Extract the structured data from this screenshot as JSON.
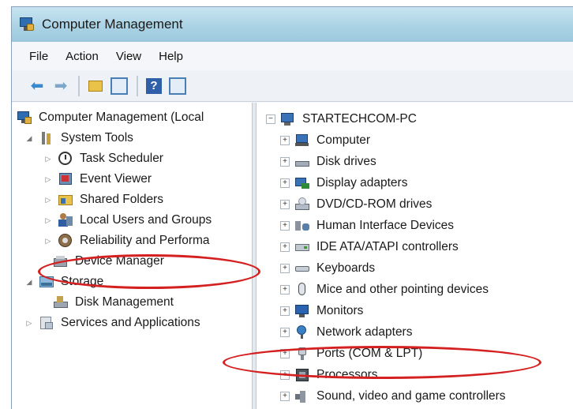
{
  "window": {
    "title": "Computer Management"
  },
  "menu": [
    "File",
    "Action",
    "View",
    "Help"
  ],
  "toolbar": [
    "back-arrow-icon",
    "forward-arrow-icon",
    "folder-up-icon",
    "show-hide-tree-icon",
    "help-icon",
    "properties-icon"
  ],
  "left_tree": [
    {
      "label": "Computer Management (Local",
      "icon": "computer-management-icon"
    },
    {
      "label": "System Tools",
      "icon": "tools-icon",
      "expander": "open"
    },
    {
      "label": "Task Scheduler",
      "icon": "clock-icon",
      "expander": "closed"
    },
    {
      "label": "Event Viewer",
      "icon": "event-viewer-icon",
      "expander": "closed"
    },
    {
      "label": "Shared Folders",
      "icon": "shared-folder-icon",
      "expander": "closed"
    },
    {
      "label": "Local Users and Groups",
      "icon": "users-icon",
      "expander": "closed"
    },
    {
      "label": "Reliability and Performa",
      "icon": "performance-icon",
      "expander": "closed"
    },
    {
      "label": "Device Manager",
      "icon": "device-manager-icon",
      "highlighted": true
    },
    {
      "label": "Storage",
      "icon": "storage-icon",
      "expander": "open"
    },
    {
      "label": "Disk Management",
      "icon": "disk-management-icon"
    },
    {
      "label": "Services and Applications",
      "icon": "services-icon",
      "expander": "closed"
    }
  ],
  "right_tree": {
    "root": "STARTECHCOM-PC",
    "items": [
      {
        "label": "Computer",
        "icon": "computer-icon"
      },
      {
        "label": "Disk drives",
        "icon": "disk-drive-icon"
      },
      {
        "label": "Display adapters",
        "icon": "display-adapter-icon"
      },
      {
        "label": "DVD/CD-ROM drives",
        "icon": "dvd-drive-icon"
      },
      {
        "label": "Human Interface Devices",
        "icon": "hid-icon"
      },
      {
        "label": "IDE ATA/ATAPI controllers",
        "icon": "ide-controller-icon"
      },
      {
        "label": "Keyboards",
        "icon": "keyboard-icon"
      },
      {
        "label": "Mice and other pointing devices",
        "icon": "mouse-icon"
      },
      {
        "label": "Monitors",
        "icon": "monitor-icon"
      },
      {
        "label": "Network adapters",
        "icon": "network-adapter-icon"
      },
      {
        "label": "Ports (COM & LPT)",
        "icon": "port-icon",
        "highlighted": true
      },
      {
        "label": "Processors",
        "icon": "processor-icon"
      },
      {
        "label": "Sound, video and game controllers",
        "icon": "sound-icon"
      }
    ]
  },
  "colors": {
    "highlight_ring": "#d42020",
    "titlebar": "#a9d2e4",
    "selection": "#3a8ad0"
  }
}
